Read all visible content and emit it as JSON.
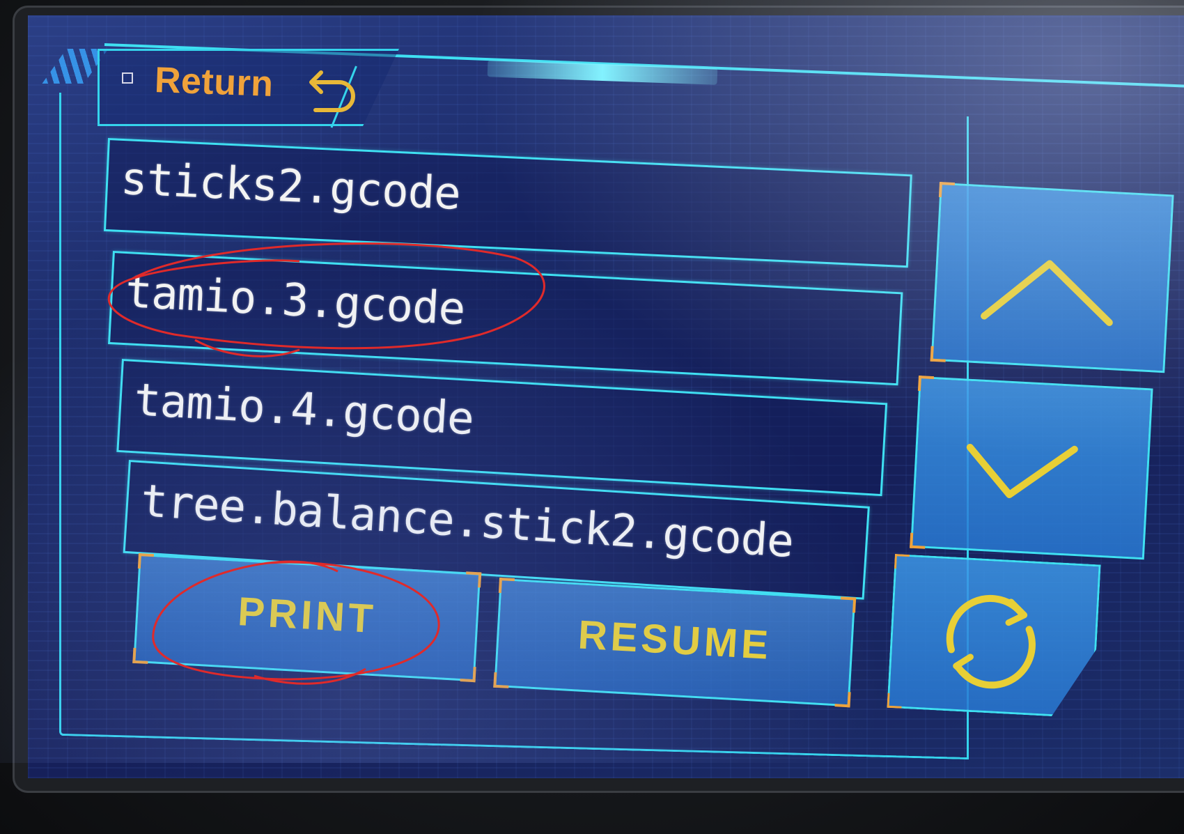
{
  "header": {
    "return_label": "Return"
  },
  "files": [
    {
      "name": "sticks2.gcode"
    },
    {
      "name": "tamio.3.gcode"
    },
    {
      "name": "tamio.4.gcode"
    },
    {
      "name": "tree.balance.stick2.gcode"
    }
  ],
  "actions": {
    "print_label": "PRINT",
    "resume_label": "RESUME"
  },
  "nav": {
    "up_icon": "chevron-up-icon",
    "down_icon": "chevron-down-icon",
    "refresh_icon": "refresh-icon"
  },
  "colors": {
    "frame": "#3fe0f2",
    "return_text": "#f0a23a",
    "button_text": "#e8cf36",
    "icon": "#e8cf36",
    "annotation": "#e02a2a"
  }
}
